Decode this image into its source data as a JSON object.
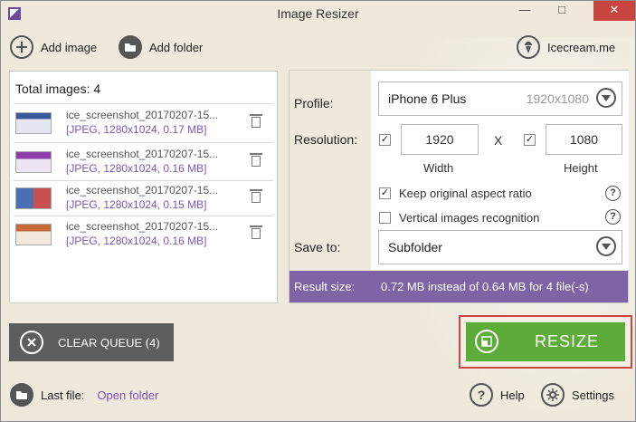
{
  "app": {
    "title": "Image Resizer"
  },
  "toolbar": {
    "add_image": "Add image",
    "add_folder": "Add folder",
    "brand": "Icecream.me"
  },
  "queue": {
    "total_label": "Total images: 4",
    "items": [
      {
        "name": "ice_screenshot_20170207-15...",
        "info": "[JPEG, 1280x1024, 0.17 MB]",
        "thumb_color": "#3b5a9a"
      },
      {
        "name": "ice_screenshot_20170207-15...",
        "info": "[JPEG, 1280x1024, 0.16 MB]",
        "thumb_color": "#8a3fa8"
      },
      {
        "name": "ice_screenshot_20170207-15...",
        "info": "[JPEG, 1280x1024, 0.15 MB]",
        "thumb_color": "#4b6fb0"
      },
      {
        "name": "ice_screenshot_20170207-15...",
        "info": "[JPEG, 1280x1024, 0.16 MB]",
        "thumb_color": "#c76b3a"
      }
    ],
    "clear_label": "CLEAR QUEUE (4)"
  },
  "settings": {
    "profile_label": "Profile:",
    "profile_value": "iPhone 6 Plus",
    "profile_dims": "1920x1080",
    "resolution_label": "Resolution:",
    "width_value": "1920",
    "height_value": "1080",
    "x_sep": "X",
    "width_label": "Width",
    "height_label": "Height",
    "keep_aspect_label": "Keep original aspect ratio",
    "keep_aspect_checked": true,
    "vertical_label": "Vertical images recognition",
    "vertical_checked": false,
    "save_to_label": "Save to:",
    "save_to_value": "Subfolder",
    "result_label": "Result size:",
    "result_value": "0.72 MB instead of 0.64 MB for 4 file(-s)"
  },
  "actions": {
    "resize_label": "RESIZE"
  },
  "footer": {
    "last_file_label": "Last file:",
    "open_folder": "Open folder",
    "help": "Help",
    "settings": "Settings"
  },
  "colors": {
    "accent": "#7d55b8",
    "resize": "#5dac3a",
    "result_bar": "#7d64a4",
    "close": "#c9453f"
  }
}
